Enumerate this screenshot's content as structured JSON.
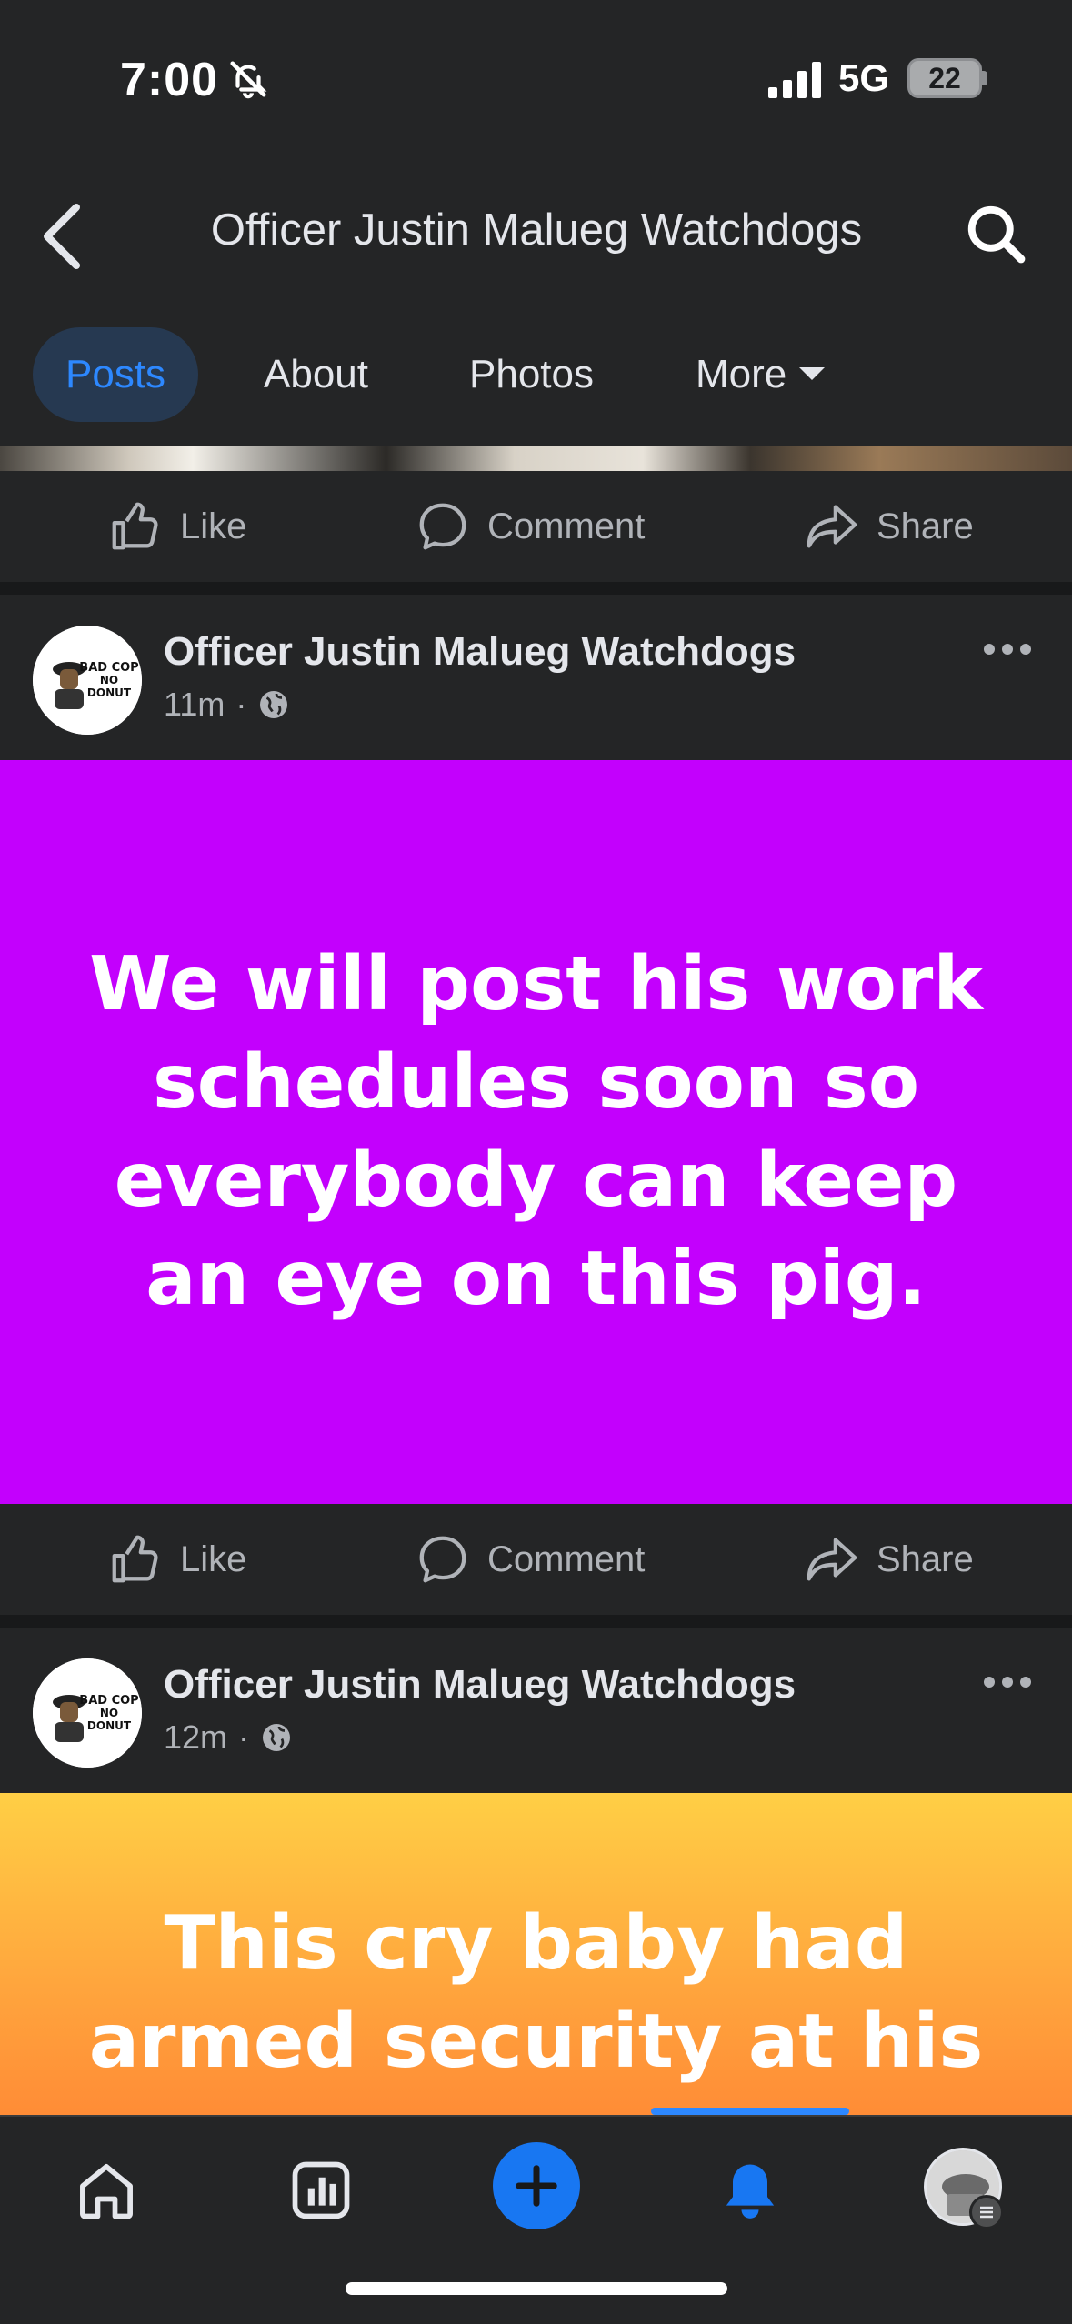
{
  "status_bar": {
    "time": "7:00",
    "network": "5G",
    "battery": "22"
  },
  "header": {
    "title": "Officer Justin Malueg Watchdogs"
  },
  "tabs": [
    {
      "label": "Posts",
      "active": true
    },
    {
      "label": "About",
      "active": false
    },
    {
      "label": "Photos",
      "active": false
    },
    {
      "label": "More",
      "active": false
    }
  ],
  "actions": {
    "like": "Like",
    "comment": "Comment",
    "share": "Share"
  },
  "posts": [
    {
      "author": "Officer Justin Malueg Watchdogs",
      "time": "11m",
      "text": "We will post his work schedules soon so everybody can keep an eye on this pig.",
      "bg": "#c300fd"
    },
    {
      "author": "Officer Justin Malueg Watchdogs",
      "time": "12m",
      "text": "This cry baby had armed security at his",
      "bg": "#ffb13d"
    }
  ],
  "avatar_text": {
    "line1": "BAD COP",
    "line2": "NO",
    "line3": "DONUT"
  },
  "icons": {
    "back": "chevron-left-icon",
    "search": "search-icon",
    "like": "thumbs-up-icon",
    "comment": "comment-bubble-icon",
    "share": "share-arrow-icon",
    "home": "home-icon",
    "dashboard": "chart-icon",
    "create": "plus-icon",
    "notifications": "bell-icon"
  },
  "colors": {
    "accent": "#2d88ff",
    "post1_bg": "#c300fd",
    "nav_active": "#1877f2"
  }
}
